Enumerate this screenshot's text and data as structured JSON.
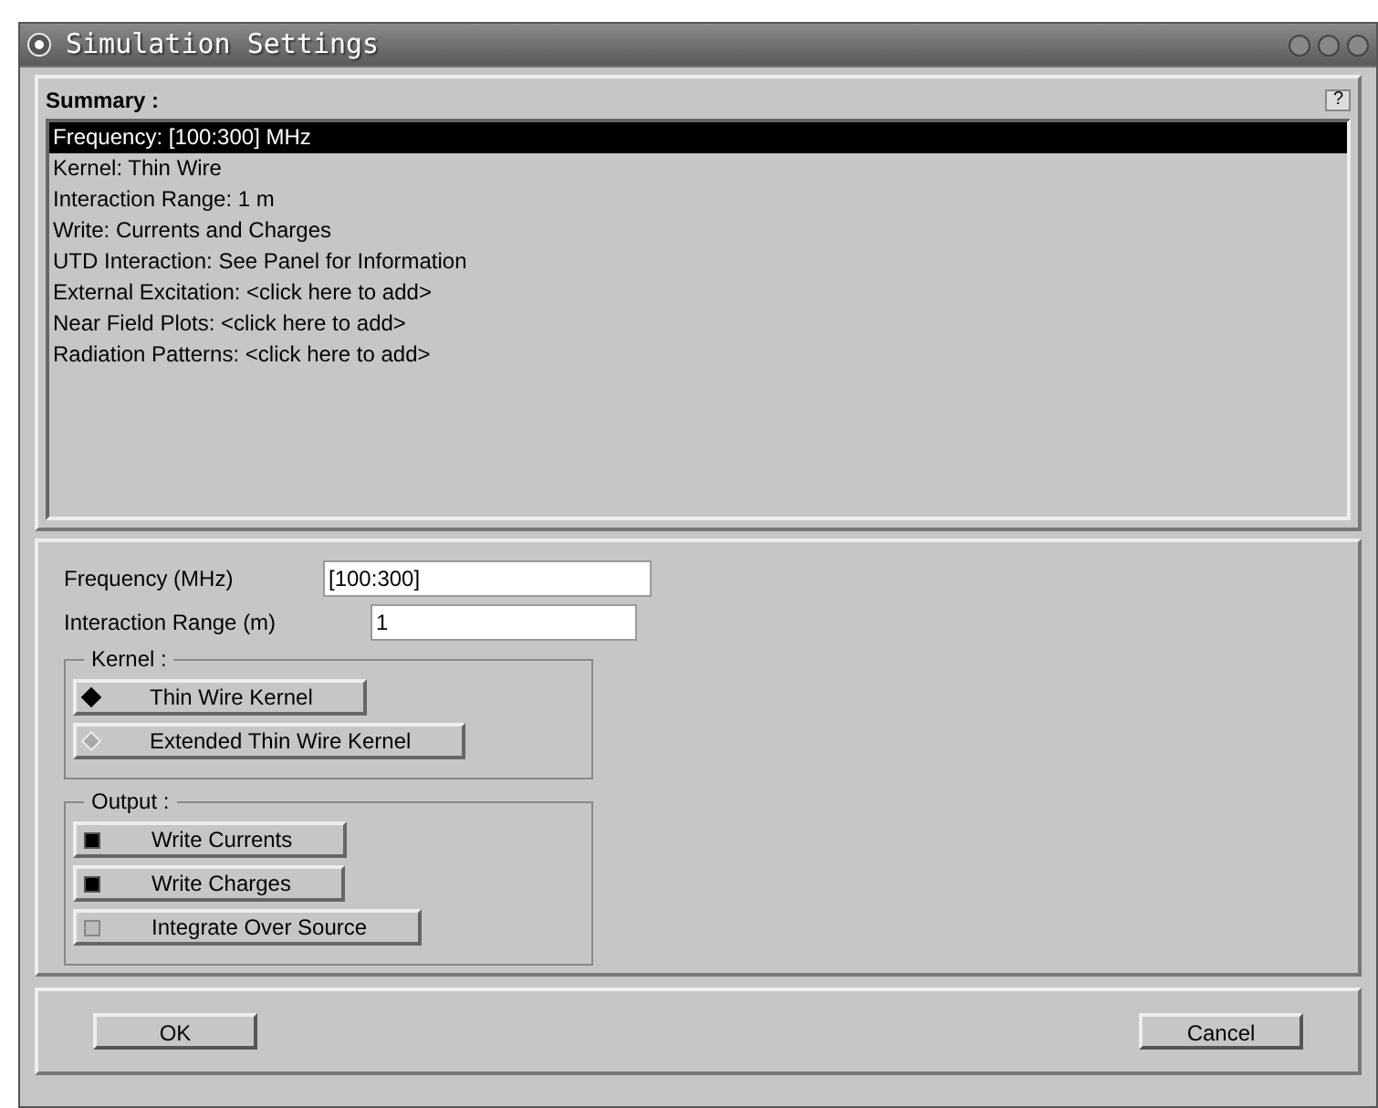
{
  "window": {
    "title": "Simulation Settings"
  },
  "summary": {
    "title": "Summary :",
    "help": "?",
    "items": [
      {
        "text": "Frequency: [100:300] MHz",
        "selected": true
      },
      {
        "text": "Kernel: Thin Wire",
        "selected": false
      },
      {
        "text": "Interaction Range: 1 m",
        "selected": false
      },
      {
        "text": "Write: Currents and Charges",
        "selected": false
      },
      {
        "text": "UTD Interaction: See Panel for Information",
        "selected": false
      },
      {
        "text": "External Excitation: <click here to add>",
        "selected": false
      },
      {
        "text": "Near Field Plots: <click here to add>",
        "selected": false
      },
      {
        "text": "Radiation Patterns: <click here to add>",
        "selected": false
      }
    ]
  },
  "fields": [
    {
      "label": "Frequency (MHz)",
      "value": "[100:300]"
    },
    {
      "label": "Interaction Range (m)",
      "value": "1"
    }
  ],
  "kernel": {
    "title": "Kernel :",
    "options": [
      {
        "label": "Thin Wire Kernel",
        "selected": true
      },
      {
        "label": "Extended Thin Wire Kernel",
        "selected": false
      }
    ]
  },
  "output": {
    "title": "Output :",
    "options": [
      {
        "label": "Write Currents",
        "checked": true
      },
      {
        "label": "Write Charges",
        "checked": true
      },
      {
        "label": "Integrate Over Source",
        "checked": false
      }
    ]
  },
  "buttons": [
    "OK",
    "Cancel"
  ]
}
